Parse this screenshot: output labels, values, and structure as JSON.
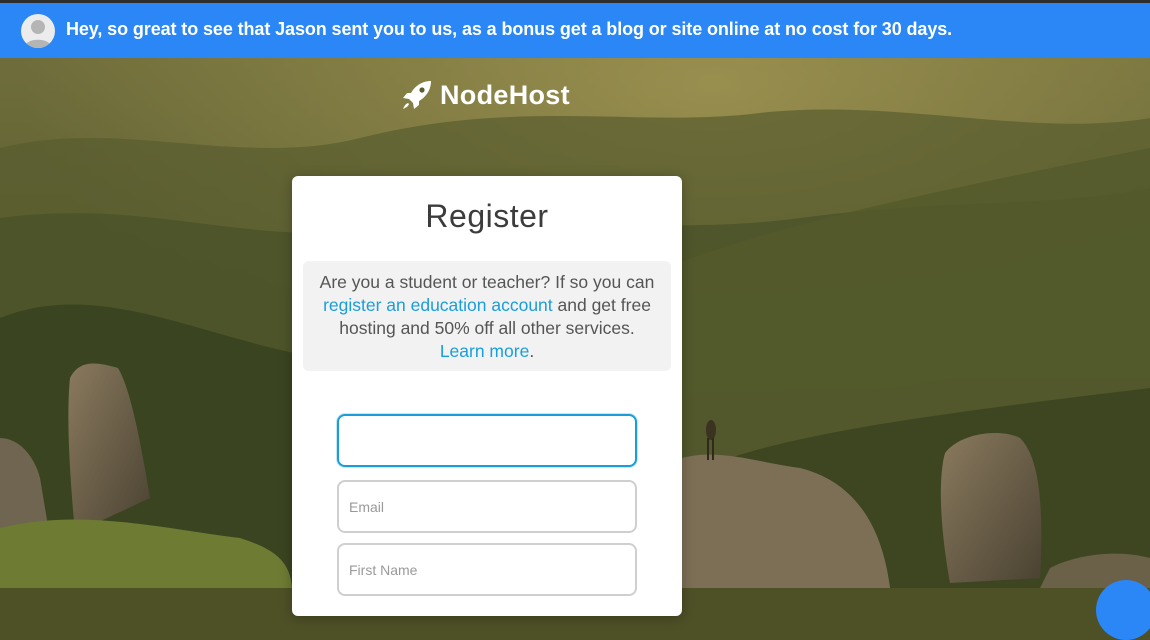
{
  "banner": {
    "message": "Hey, so great to see that Jason sent you to us, as a bonus get a blog or site online at no cost for 30 days."
  },
  "logo": {
    "icon": "rocket-icon",
    "name": "NodeHost"
  },
  "register": {
    "title": "Register",
    "edu_text_1": "Are you a student or teacher? If so you can ",
    "edu_link": "register an education account",
    "edu_text_2": " and get free hosting and 50% off all other services. ",
    "learn_more": "Learn more",
    "edu_text_3": "."
  },
  "form": {
    "username_placeholder": "",
    "email_placeholder": "Email",
    "first_name_placeholder": "First Name"
  },
  "colors": {
    "banner": "#2a87f5",
    "link": "#1a9ed9",
    "focus_border": "#1a9ed9"
  }
}
